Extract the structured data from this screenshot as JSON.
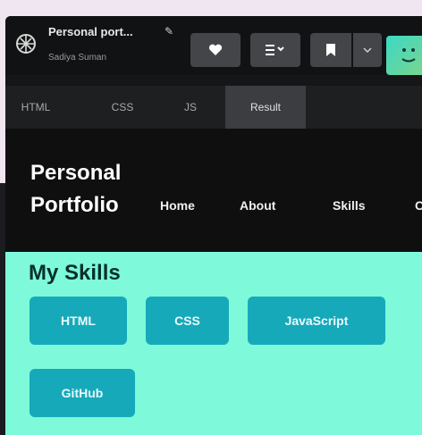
{
  "header": {
    "pen_title": "Personal port...",
    "author": "Sadiya Suman",
    "edit_icon": "pencil-icon",
    "buttons": [
      {
        "name": "heart-button",
        "icon": "heart-icon"
      },
      {
        "name": "layout-button",
        "icon": "layout-icon"
      },
      {
        "name": "bookmark-button",
        "icon": "bookmark-icon"
      },
      {
        "name": "more-button",
        "icon": "chevron-down-icon"
      }
    ]
  },
  "tabs": [
    {
      "label": "HTML"
    },
    {
      "label": "CSS"
    },
    {
      "label": "JS"
    },
    {
      "label": "Result",
      "active": true
    }
  ],
  "result": {
    "brand_line1": "Personal",
    "brand_line2": "Portfolio",
    "nav": [
      {
        "label": "Home"
      },
      {
        "label": "About"
      },
      {
        "label": "Skills"
      },
      {
        "label": "C"
      }
    ],
    "skills_title": "My Skills",
    "skills": [
      {
        "label": "HTML"
      },
      {
        "label": "CSS"
      },
      {
        "label": "JavaScript"
      },
      {
        "label": "GitHub"
      }
    ]
  },
  "colors": {
    "accent": "#7ef9d9",
    "chip": "#16a9b9",
    "dark": "#151617"
  }
}
